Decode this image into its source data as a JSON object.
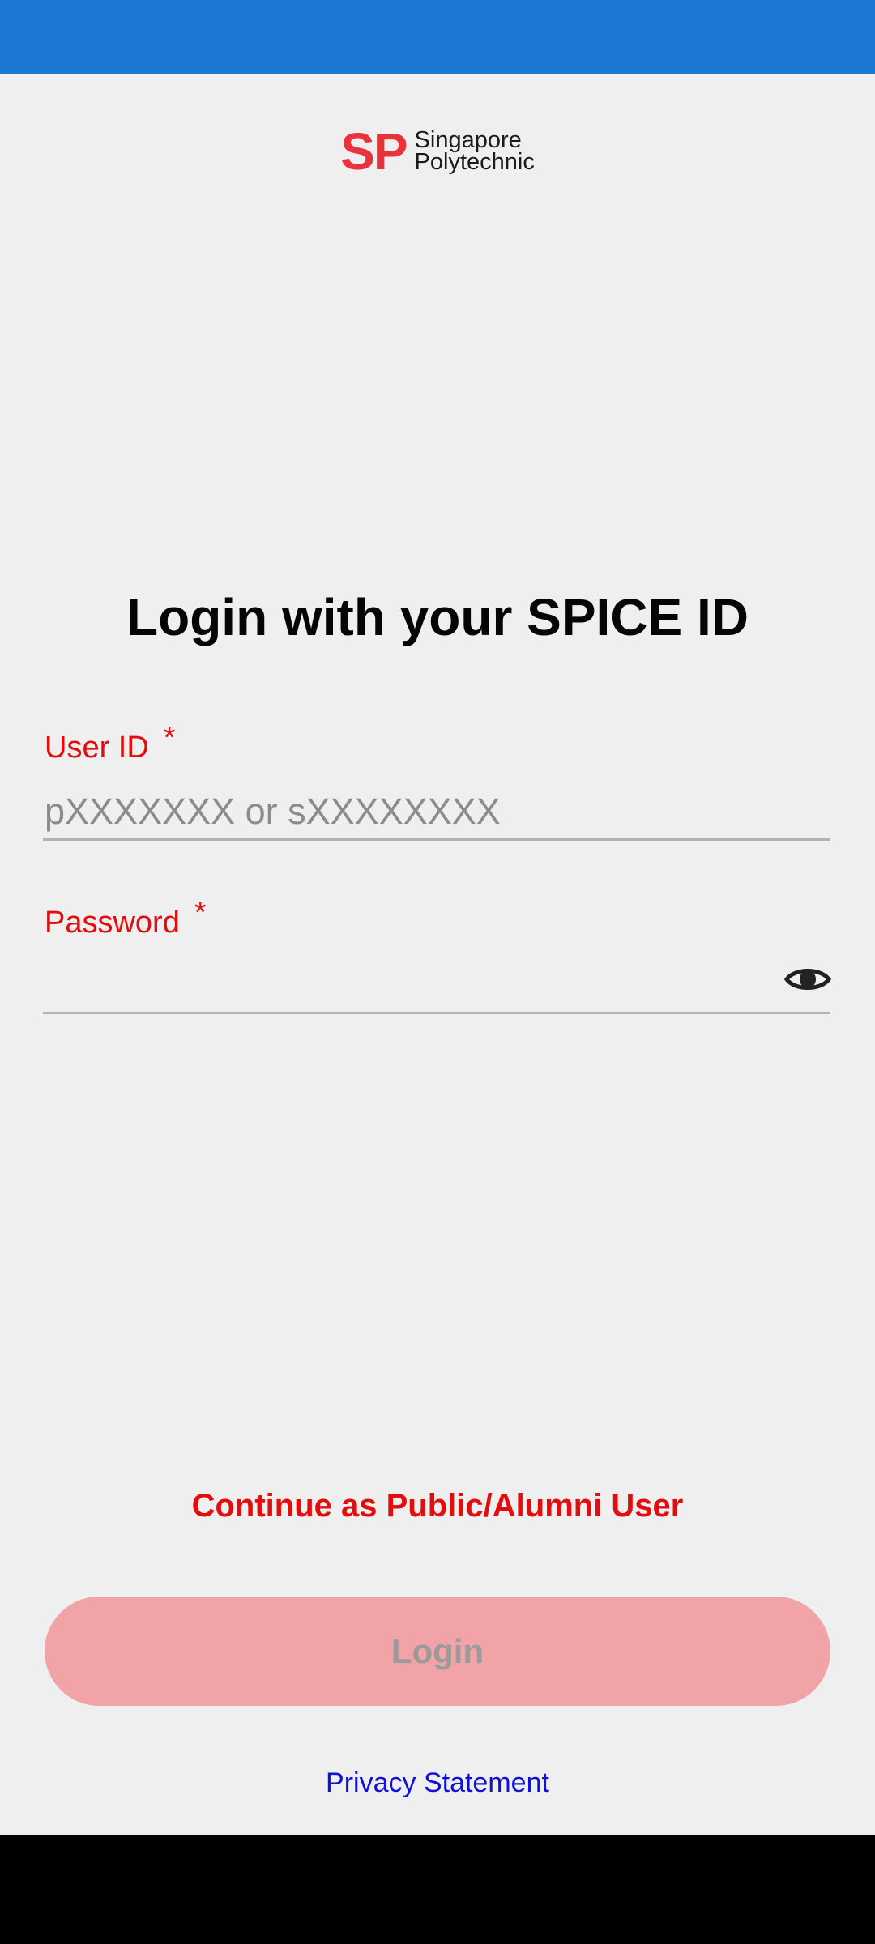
{
  "colors": {
    "status_bar": "#1a78d2",
    "background": "#efefef",
    "accent_red": "#e30d0d",
    "logo_red": "#e8333d",
    "login_button_disabled": "#f1a3a7",
    "link_blue": "#1010d8"
  },
  "logo": {
    "mark": "SP",
    "line1": "Singapore",
    "line2": "Polytechnic"
  },
  "heading": "Login with your SPICE ID",
  "user_id": {
    "label": "User ID",
    "required_mark": "*",
    "placeholder": "pXXXXXXX or sXXXXXXXX",
    "value": ""
  },
  "password": {
    "label": "Password",
    "required_mark": "*",
    "value": "",
    "toggle_icon": "eye-icon"
  },
  "public_user_link": "Continue as Public/Alumni User",
  "login_button": "Login",
  "privacy_link": "Privacy Statement"
}
